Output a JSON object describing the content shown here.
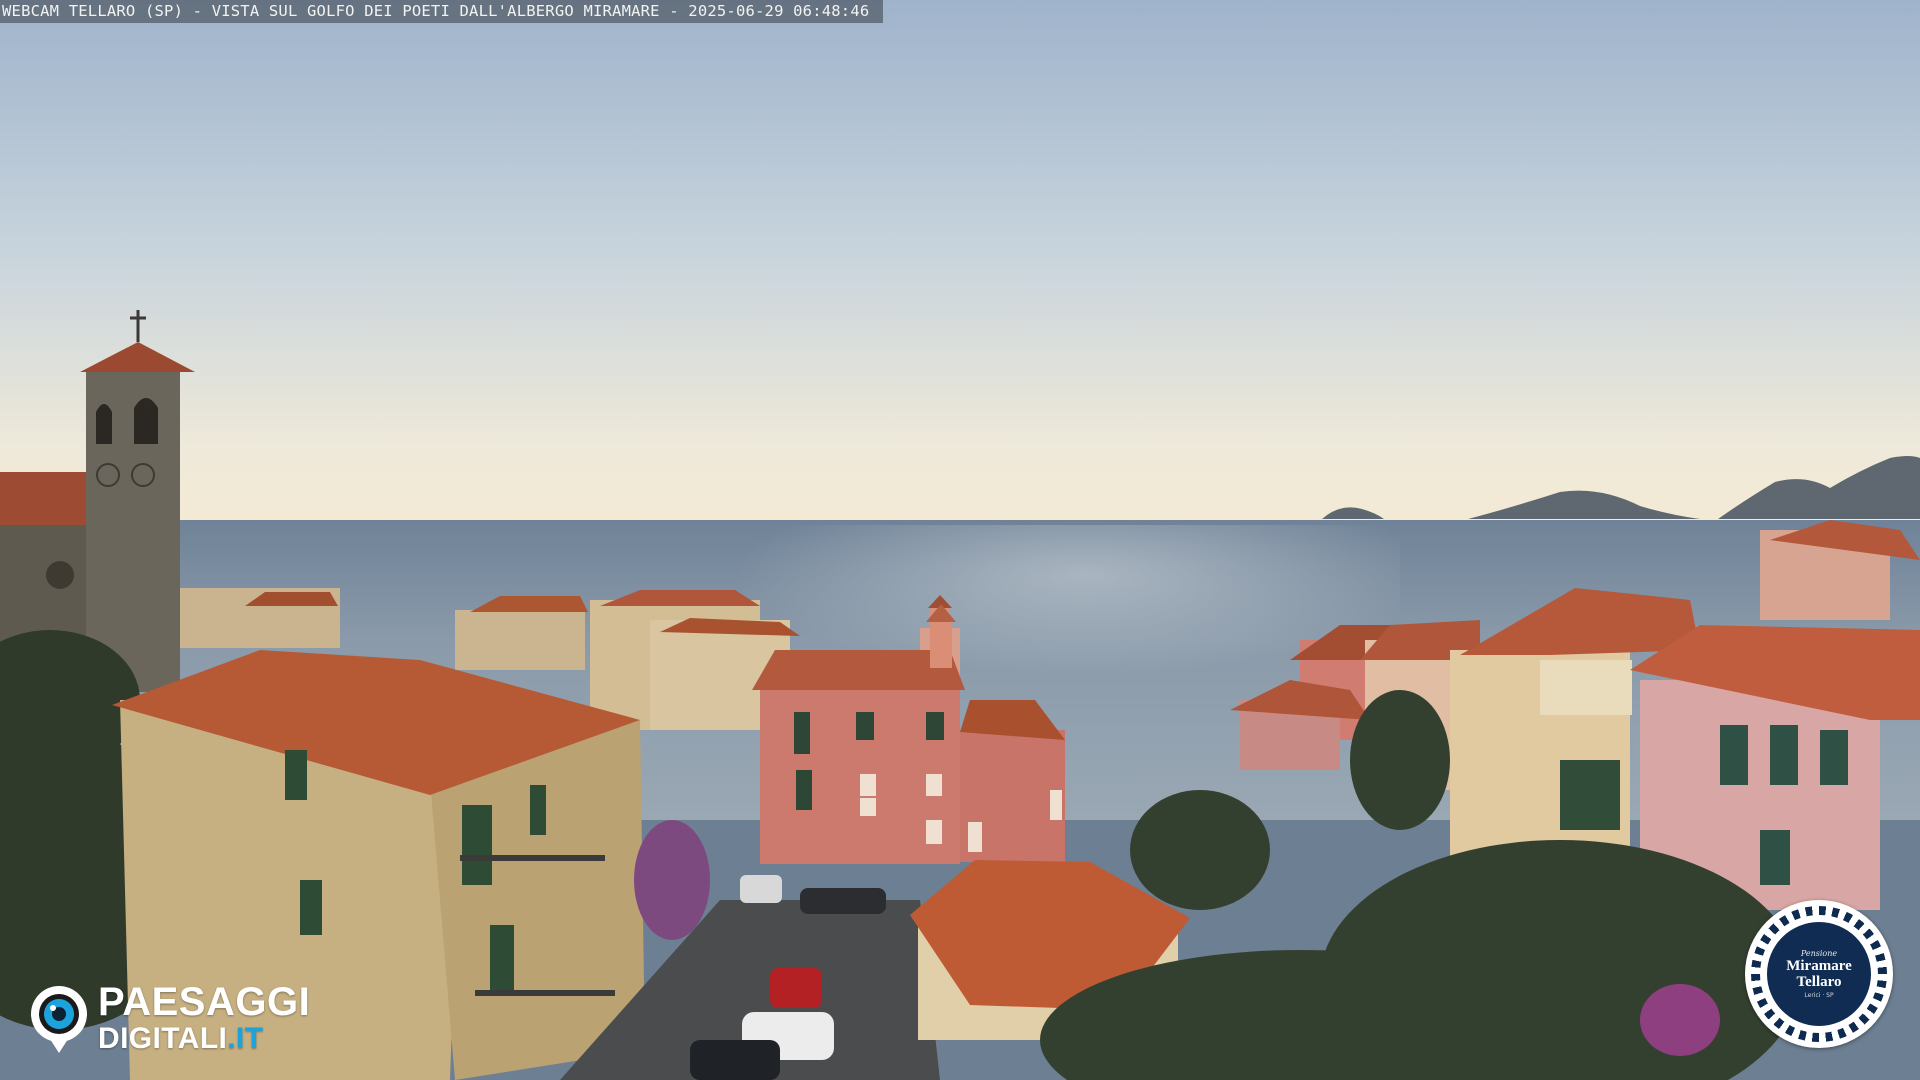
{
  "caption": {
    "text": "WEBCAM TELLARO (SP) - VISTA SUL GOLFO DEI POETI DALL'ALBERGO MIRAMARE - 2025-06-29 06:48:46"
  },
  "watermark": {
    "line1": "PAESAGGI",
    "line2_main": "DIGITALI",
    "line2_accent": ".IT",
    "icon": "camera-lens-icon"
  },
  "seal": {
    "small_text": "Pensione",
    "name_line1": "Miramare",
    "name_line2": "Tellaro",
    "sub_text": "Lerici · SP"
  },
  "colors": {
    "sky_top": "#9fb3cb",
    "sky_horizon": "#f2ead6",
    "sea": "#7c8ea0",
    "roof_terracotta": "#b4532f",
    "watermark_accent": "#1da3dc",
    "seal_navy": "#102c52"
  }
}
